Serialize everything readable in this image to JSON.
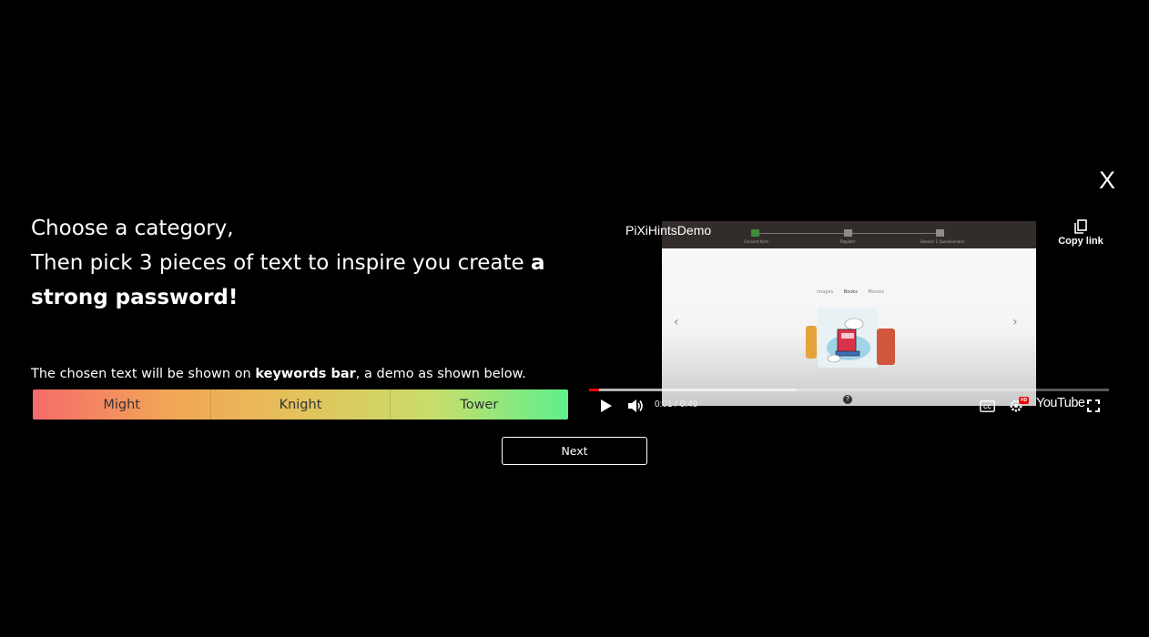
{
  "close_label": "X",
  "headline": {
    "line1": "Choose a category,",
    "line2_prefix": "Then pick 3 pieces of text to inspire you create ",
    "line2_bold": "a strong password!"
  },
  "note": {
    "prefix": "The chosen text will be shown on ",
    "bold": "keywords bar",
    "suffix": ", a demo as shown below."
  },
  "keywords_bar": {
    "words": [
      "Might",
      "Knight",
      "Tower"
    ],
    "colors": [
      "#f56b6b",
      "#f3a556",
      "#e3c25b",
      "#c8de6b",
      "#5ef08c"
    ]
  },
  "next_label": "Next",
  "video": {
    "title": "PiXiHintsDemo",
    "copy_link_label": "Copy link",
    "timecode": "0:01 / 0:49",
    "played_fraction": 0.02,
    "loaded_fraction": 0.4,
    "brand": "YouTube",
    "hd_badge": "HD",
    "thumbnail": {
      "step_labels": [
        "Consent form",
        "Register",
        "Session 1 Questionnaire"
      ],
      "tabs": [
        "Images",
        "Books",
        "Movies"
      ]
    },
    "icons": [
      "play-icon",
      "volume-icon",
      "captions-icon",
      "settings-icon",
      "fullscreen-icon",
      "copy-icon"
    ]
  }
}
